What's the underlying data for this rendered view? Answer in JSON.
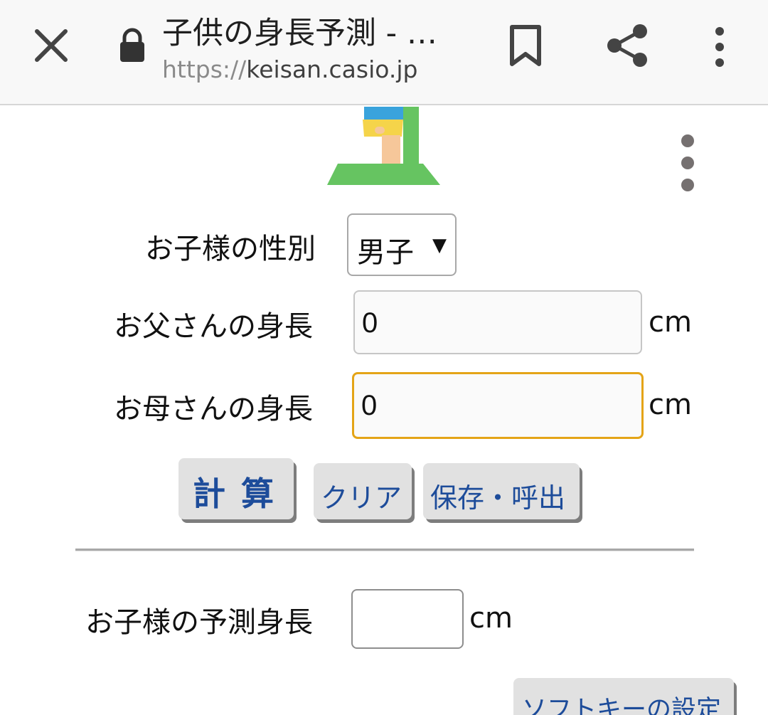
{
  "browser": {
    "title": "子供の身長予測 - …",
    "url_scheme": "https://",
    "url_host": "keisan.casio.jp",
    "icons": [
      "close-icon",
      "lock-icon",
      "bookmark-icon",
      "share-icon",
      "more-vert-icon"
    ]
  },
  "form": {
    "gender_label": "お子様の性別",
    "gender_value": "男子",
    "gender_arrow": "▼",
    "father_label": "お父さんの身長",
    "father_value": "0",
    "mother_label": "お母さんの身長",
    "mother_value": "0",
    "unit": "cm"
  },
  "buttons": {
    "calculate": "計算",
    "clear": "クリア",
    "save_load": "保存・呼出",
    "softkey": "ソフトキーの設定"
  },
  "result": {
    "label": "お子様の予測身長",
    "value": "",
    "unit": "cm"
  },
  "colors": {
    "button_text": "#1d4c9a",
    "focus_border": "#e4a417",
    "button_bg": "#e1e1e1"
  }
}
